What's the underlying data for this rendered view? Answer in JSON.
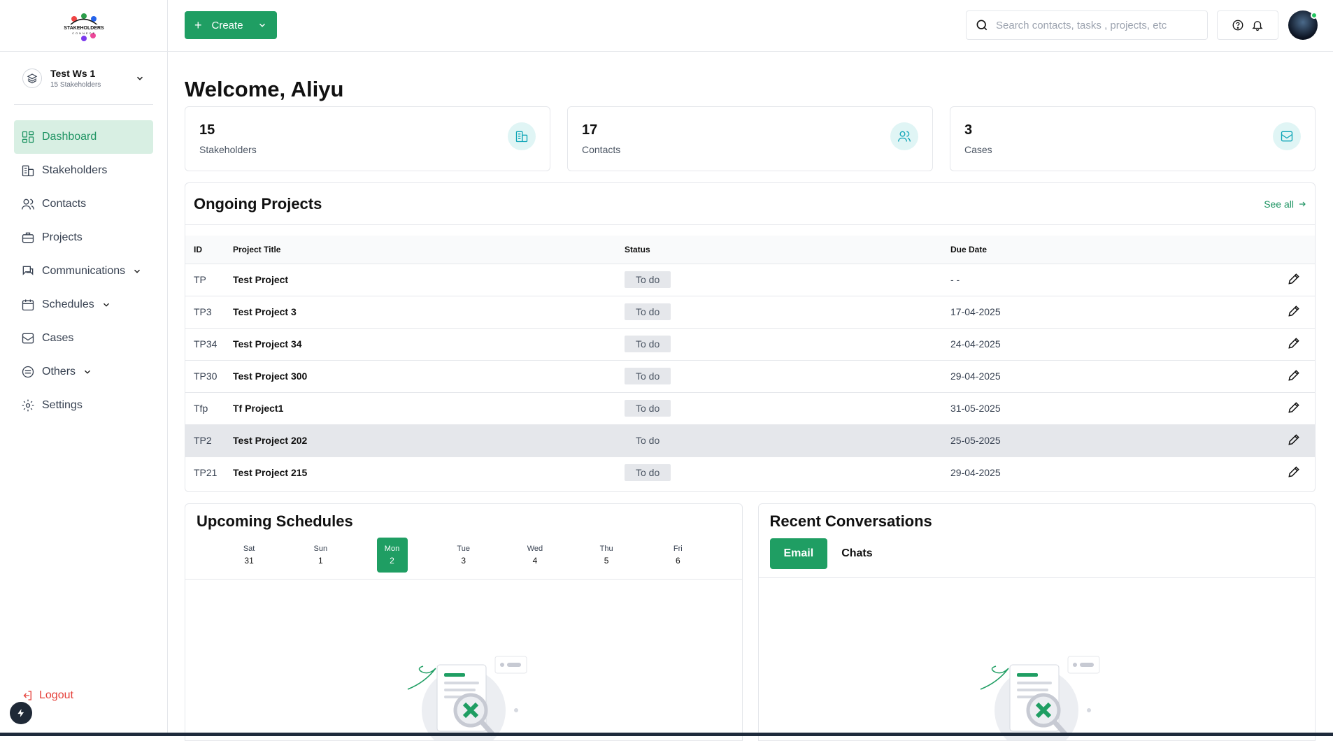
{
  "brand": {
    "logo_text": "STAKEHOLDERS CONNECT"
  },
  "workspace": {
    "name": "Test Ws 1",
    "subtitle": "15 Stakeholders"
  },
  "sidebar": {
    "items": [
      {
        "label": "Dashboard",
        "icon": "dashboard-icon",
        "active": true
      },
      {
        "label": "Stakeholders",
        "icon": "building-icon"
      },
      {
        "label": "Contacts",
        "icon": "users-icon"
      },
      {
        "label": "Projects",
        "icon": "briefcase-icon"
      },
      {
        "label": "Communications",
        "icon": "chat-icon",
        "expandable": true
      },
      {
        "label": "Schedules",
        "icon": "calendar-icon",
        "expandable": true
      },
      {
        "label": "Cases",
        "icon": "inbox-icon"
      },
      {
        "label": "Others",
        "icon": "layers-icon",
        "expandable": true
      },
      {
        "label": "Settings",
        "icon": "gear-icon"
      }
    ],
    "logout": "Logout"
  },
  "toolbar": {
    "create_label": "Create",
    "search_placeholder": "Search contacts, tasks , projects, etc"
  },
  "welcome": "Welcome, Aliyu",
  "stats": [
    {
      "value": "15",
      "label": "Stakeholders"
    },
    {
      "value": "17",
      "label": "Contacts"
    },
    {
      "value": "3",
      "label": "Cases"
    }
  ],
  "projects": {
    "title": "Ongoing Projects",
    "see_all": "See all",
    "columns": [
      "ID",
      "Project Title",
      "Status",
      "Due Date"
    ],
    "rows": [
      {
        "id": "TP",
        "title": "Test Project",
        "status": "To do",
        "due": "- -"
      },
      {
        "id": "TP3",
        "title": "Test Project 3",
        "status": "To do",
        "due": "17-04-2025"
      },
      {
        "id": "TP34",
        "title": "Test Project 34",
        "status": "To do",
        "due": "24-04-2025"
      },
      {
        "id": "TP30",
        "title": "Test Project 300",
        "status": "To do",
        "due": "29-04-2025"
      },
      {
        "id": "Tfp",
        "title": "Tf Project1",
        "status": "To do",
        "due": "31-05-2025"
      },
      {
        "id": "TP2",
        "title": "Test Project 202",
        "status": "To do",
        "due": "25-05-2025"
      },
      {
        "id": "TP21",
        "title": "Test Project 215",
        "status": "To do",
        "due": "29-04-2025"
      }
    ]
  },
  "schedules": {
    "title": "Upcoming Schedules",
    "days": [
      {
        "name": "Sat",
        "date": "31"
      },
      {
        "name": "Sun",
        "date": "1"
      },
      {
        "name": "Mon",
        "date": "2",
        "selected": true
      },
      {
        "name": "Tue",
        "date": "3"
      },
      {
        "name": "Wed",
        "date": "4"
      },
      {
        "name": "Thu",
        "date": "5"
      },
      {
        "name": "Fri",
        "date": "6"
      }
    ]
  },
  "conversations": {
    "title": "Recent Conversations",
    "tabs": [
      {
        "label": "Email",
        "active": true
      },
      {
        "label": "Chats"
      }
    ]
  },
  "colors": {
    "accent": "#1f9e63",
    "accent_light": "#d8efe3",
    "danger": "#e5413b"
  }
}
